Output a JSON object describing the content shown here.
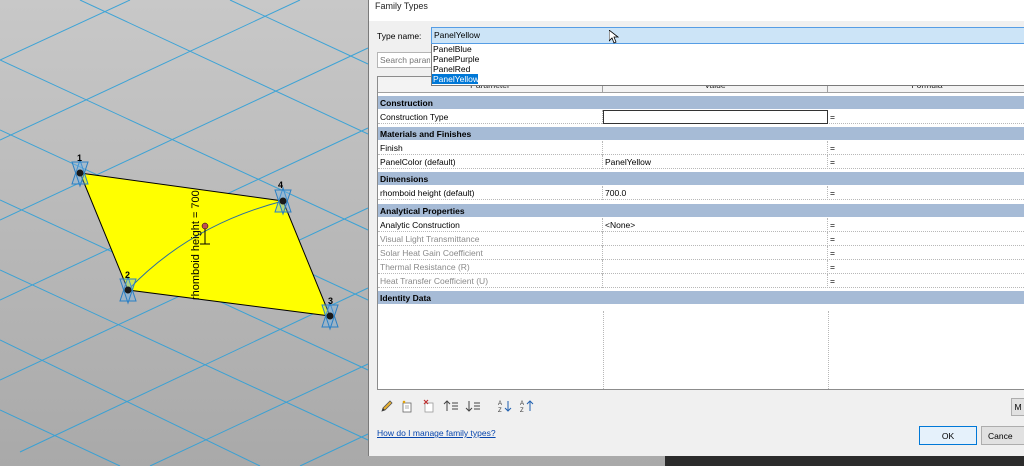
{
  "viewport": {
    "points": [
      "1",
      "2",
      "3",
      "4"
    ],
    "dimension_label": "rhomboid height = 700",
    "colors": {
      "panel": "#ffff00",
      "grid": "#2fa0d8",
      "background": "#b8b8b8"
    }
  },
  "dialog": {
    "title": "Family Types",
    "type_name_label": "Type name:",
    "type_name_value": "PanelYellow",
    "search_placeholder": "Search parameters",
    "type_options": [
      "PanelBlue",
      "PanelPurple",
      "PanelRed",
      "PanelYellow"
    ],
    "selected_option": "PanelYellow",
    "columns": [
      "Parameter",
      "Value",
      "Formula"
    ],
    "groups": {
      "construction": {
        "title": "Construction",
        "rows": [
          {
            "param": "Construction Type",
            "value": "",
            "formula": "="
          }
        ]
      },
      "materials": {
        "title": "Materials and Finishes",
        "rows": [
          {
            "param": "Finish",
            "value": "",
            "formula": "="
          },
          {
            "param": "PanelColor (default)",
            "value": "PanelYellow",
            "formula": "="
          }
        ]
      },
      "dimensions": {
        "title": "Dimensions",
        "rows": [
          {
            "param": "rhomboid height (default)",
            "value": "700.0",
            "formula": "="
          }
        ]
      },
      "analytical": {
        "title": "Analytical Properties",
        "rows": [
          {
            "param": "Analytic Construction",
            "value": "<None>",
            "formula": "="
          },
          {
            "param": "Visual Light Transmittance",
            "value": "",
            "formula": "="
          },
          {
            "param": "Solar Heat Gain Coefficient",
            "value": "",
            "formula": "="
          },
          {
            "param": "Thermal Resistance (R)",
            "value": "",
            "formula": "="
          },
          {
            "param": "Heat Transfer Coefficient (U)",
            "value": "",
            "formula": "="
          }
        ]
      },
      "identity": {
        "title": "Identity Data"
      }
    },
    "toolbar_icons": [
      "pencil-icon",
      "new-type-icon",
      "delete-type-icon",
      "move-up-icon",
      "move-down-icon",
      "sort-ascending-icon",
      "sort-descending-icon"
    ],
    "manage_button_label": "M",
    "help_link": "How do I manage family types?",
    "ok_label": "OK",
    "cancel_label": "Cance"
  }
}
